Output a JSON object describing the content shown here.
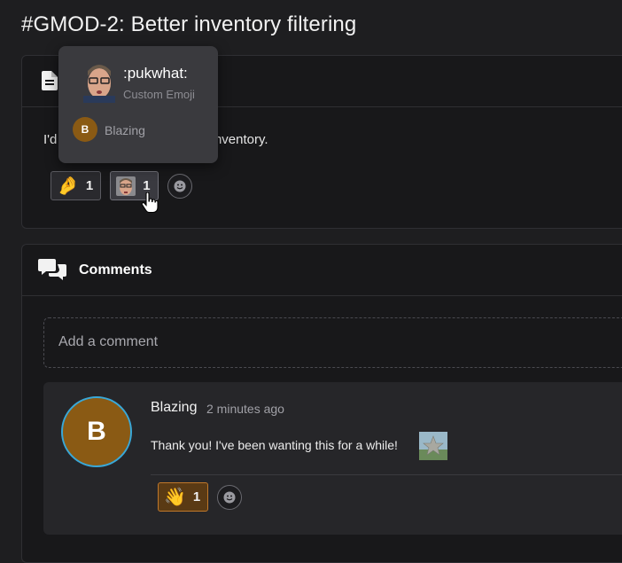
{
  "page": {
    "title": "#GMOD-2: Better inventory filtering"
  },
  "description": {
    "text": "I'd like to be able to filter my inventory.",
    "reactions": [
      {
        "emoji": "🤌",
        "count": "1"
      },
      {
        "emoji_name": ":pukwhat:",
        "count": "1"
      }
    ]
  },
  "tooltip": {
    "emoji_name": ":pukwhat:",
    "emoji_type": "Custom Emoji",
    "user_initial": "B",
    "user_name": "Blazing"
  },
  "comments": {
    "title": "Comments",
    "add_placeholder": "Add a comment",
    "items": [
      {
        "author_initial": "B",
        "author": "Blazing",
        "time": "2 minutes ago",
        "text": "Thank you! I've been wanting this for a while!",
        "reactions": [
          {
            "emoji": "👋",
            "count": "1"
          }
        ]
      }
    ]
  },
  "colors": {
    "background": "#1e1e20",
    "card": "#18181a",
    "avatar": "#8a5a14",
    "avatar_ring": "#39a8d8"
  }
}
